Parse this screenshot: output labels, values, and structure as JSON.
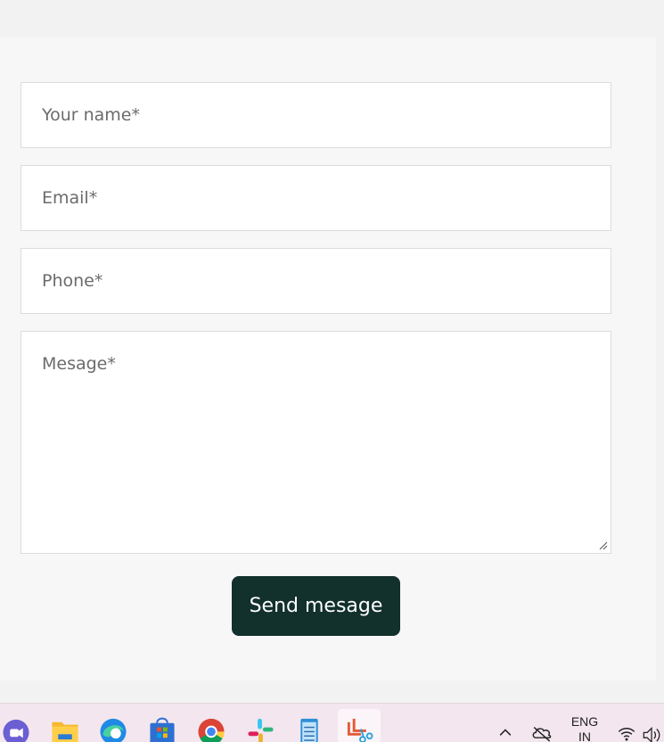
{
  "form": {
    "name_placeholder": "Your name*",
    "email_placeholder": "Email*",
    "phone_placeholder": "Phone*",
    "message_placeholder": "Mesage*",
    "submit_label": "Send mesage",
    "button_color": "#12302c"
  },
  "taskbar": {
    "apps": [
      "zoom-icon",
      "file-explorer-icon",
      "edge-icon",
      "microsoft-store-icon",
      "chrome-icon",
      "slack-icon",
      "notepad-icon",
      "snipping-tool-icon"
    ],
    "active_app": "snipping-tool-icon",
    "tray": {
      "language": "ENG",
      "region": "IN",
      "icons": [
        "chevron-up-icon",
        "onedrive-offline-icon",
        "wifi-icon",
        "speaker-icon"
      ]
    }
  }
}
